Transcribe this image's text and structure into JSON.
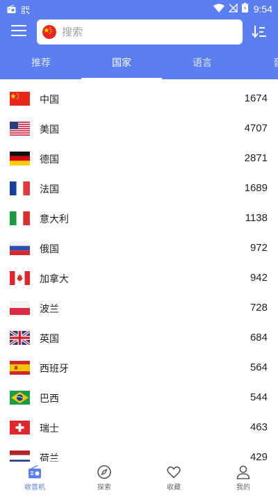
{
  "status_bar": {
    "time": "9:54"
  },
  "search": {
    "placeholder": "搜索"
  },
  "tabs": [
    "推荐",
    "国家",
    "语言",
    "音乐"
  ],
  "active_tab": 1,
  "countries": [
    {
      "flag": "cn-flag-icon",
      "name": "中国",
      "count": "1674"
    },
    {
      "flag": "us-flag-icon",
      "name": "美国",
      "count": "4707"
    },
    {
      "flag": "de-flag-icon",
      "name": "德国",
      "count": "2871"
    },
    {
      "flag": "fr-flag-icon",
      "name": "法国",
      "count": "1689"
    },
    {
      "flag": "it-flag-icon",
      "name": "意大利",
      "count": "1138"
    },
    {
      "flag": "ru-flag-icon",
      "name": "俄国",
      "count": "972"
    },
    {
      "flag": "ca-flag-icon",
      "name": "加拿大",
      "count": "942"
    },
    {
      "flag": "pl-flag-icon",
      "name": "波兰",
      "count": "728"
    },
    {
      "flag": "gb-flag-icon",
      "name": "英国",
      "count": "684"
    },
    {
      "flag": "es-flag-icon",
      "name": "西班牙",
      "count": "564"
    },
    {
      "flag": "br-flag-icon",
      "name": "巴西",
      "count": "544"
    },
    {
      "flag": "ch-flag-icon",
      "name": "瑞士",
      "count": "463"
    },
    {
      "flag": "nl-flag-icon",
      "name": "荷兰",
      "count": "429"
    }
  ],
  "bottom_nav": [
    {
      "icon": "radio-icon",
      "label": "收音机"
    },
    {
      "icon": "compass-icon",
      "label": "探索"
    },
    {
      "icon": "heart-icon",
      "label": "收藏"
    },
    {
      "icon": "person-icon",
      "label": "我的"
    }
  ],
  "active_nav": 0,
  "colors": {
    "primary": "#5b7ef2",
    "text": "#222222",
    "nav_inactive": "#666666"
  }
}
